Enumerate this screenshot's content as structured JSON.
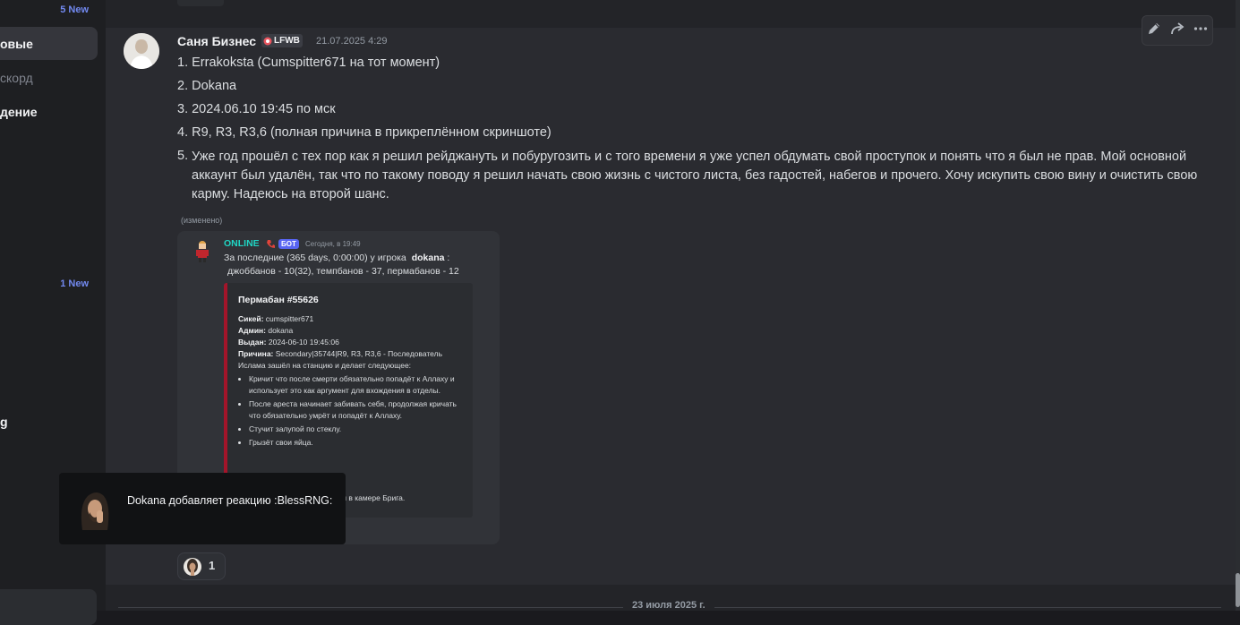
{
  "sidebar": {
    "new_badge_top": "5 New",
    "items": [
      {
        "label": "овые"
      },
      {
        "label": "скорд"
      },
      {
        "label": "дение"
      }
    ],
    "new_badge_mid": "1 New",
    "item_g": "g"
  },
  "message": {
    "author": "Саня Бизнес",
    "tag": "LFWB",
    "timestamp": "21.07.2025 4:29",
    "lines": [
      "1. Errakoksta (Cumspitter671 на тот момент)",
      "2. Dokana",
      "3. 2024.06.10 19:45 по мск",
      "4. R9, R3, R3,6 (полная причина в прикреплённом скриншоте)"
    ],
    "line5_num": "5.",
    "line5": "Уже год прошёл с тех пор как я решил рейджануть и побуругозить и с того времени я уже успел обдумать свой проступок и понять что я был не прав. Мой основной аккаунт был удалён, так что по такому поводу я решил начать свою жизнь с чистого листа, без гадостей, набегов и прочего. Хочу искупить свою вину и очистить свою карму. Надеюсь на второй шанс.",
    "edited": "(изменено)"
  },
  "screenshot": {
    "bot_name": "ONLINE",
    "bot_badge": "БОТ",
    "bot_time": "Сегодня, в 19:49",
    "summary_1": "За последние (365 days, 0:00:00) у игрока",
    "summary_player": "dokana",
    "summary_colon": ":",
    "summary_2": "джоббанов - 10(32), темпбанов - 37, пермабанов - 12",
    "card_title": "Пермабан #55626",
    "ckey_label": "Сикей:",
    "ckey": "cumspitter671",
    "admin_label": "Админ:",
    "admin": "dokana",
    "issued_label": "Выдан:",
    "issued": "2024-06-10 19:45:06",
    "reason_label": "Причина:",
    "reason": "Secondary|35744|R9, R3, R3,6 - Последователь Ислама зашёл на станцию и делает следующее:",
    "bullets": [
      "Кричит что после смерти обязательно попадёт к Аллаху и использует это как аргумент для вхождения в отделы.",
      "После ареста начинает забивать себя, продолжая кричать что обязательно умрёт и попадёт к Аллаху.",
      "Стучит залупой по стеклу.",
      "Грызёт свои яйца."
    ],
    "hidden_tail": "ым в камере Брига."
  },
  "reaction": {
    "count": "1"
  },
  "divider": {
    "date": "23 июля 2025 г."
  },
  "toast": {
    "text": "Dokana добавляет реакцию :BlessRNG:"
  },
  "colors": {
    "accent": "#5865f2",
    "badge": "#7289f0",
    "bot_name": "#20d6c4",
    "embed_border": "#a3152a"
  },
  "icons": [
    "pencil-icon",
    "forward-icon",
    "more-icon"
  ]
}
